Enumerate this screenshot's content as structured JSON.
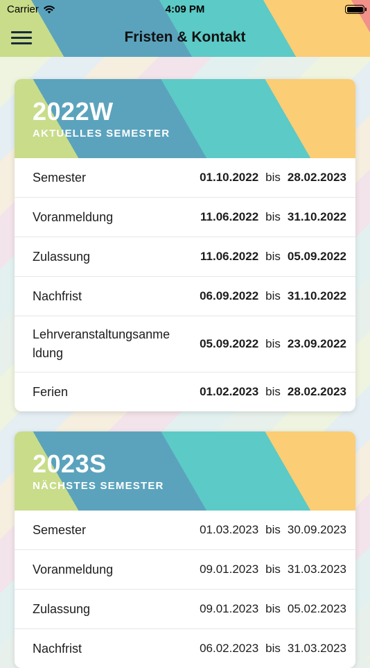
{
  "status_bar": {
    "carrier": "Carrier",
    "time": "4:09 PM"
  },
  "nav": {
    "title": "Fristen & Kontakt"
  },
  "semesters": [
    {
      "code": "2022W",
      "label": "AKTUELLES SEMESTER",
      "rows": [
        {
          "label": "Semester",
          "start": "01.10.2022",
          "sep": "bis",
          "end": "28.02.2023"
        },
        {
          "label": "Voranmeldung",
          "start": "11.06.2022",
          "sep": "bis",
          "end": "31.10.2022"
        },
        {
          "label": "Zulassung",
          "start": "11.06.2022",
          "sep": "bis",
          "end": "05.09.2022"
        },
        {
          "label": "Nachfrist",
          "start": "06.09.2022",
          "sep": "bis",
          "end": "31.10.2022"
        },
        {
          "label": "Lehrveranstaltungsanmeldung",
          "start": "05.09.2022",
          "sep": "bis",
          "end": "23.09.2022"
        },
        {
          "label": "Ferien",
          "start": "01.02.2023",
          "sep": "bis",
          "end": "28.02.2023"
        }
      ]
    },
    {
      "code": "2023S",
      "label": "NÄCHSTES SEMESTER",
      "rows": [
        {
          "label": "Semester",
          "start": "01.03.2023",
          "sep": "bis",
          "end": "30.09.2023"
        },
        {
          "label": "Voranmeldung",
          "start": "09.01.2023",
          "sep": "bis",
          "end": "31.03.2023"
        },
        {
          "label": "Zulassung",
          "start": "09.01.2023",
          "sep": "bis",
          "end": "05.02.2023"
        },
        {
          "label": "Nachfrist",
          "start": "06.02.2023",
          "sep": "bis",
          "end": "31.03.2023"
        }
      ]
    }
  ],
  "icons": {
    "menu": "hamburger-menu-icon",
    "wifi": "wifi-icon",
    "battery": "battery-icon"
  },
  "colors": {
    "green": "#c8dc8a",
    "blue": "#5ba3bd",
    "teal": "#5ccac6",
    "yellow": "#fbcd74",
    "red": "#f1918a"
  }
}
